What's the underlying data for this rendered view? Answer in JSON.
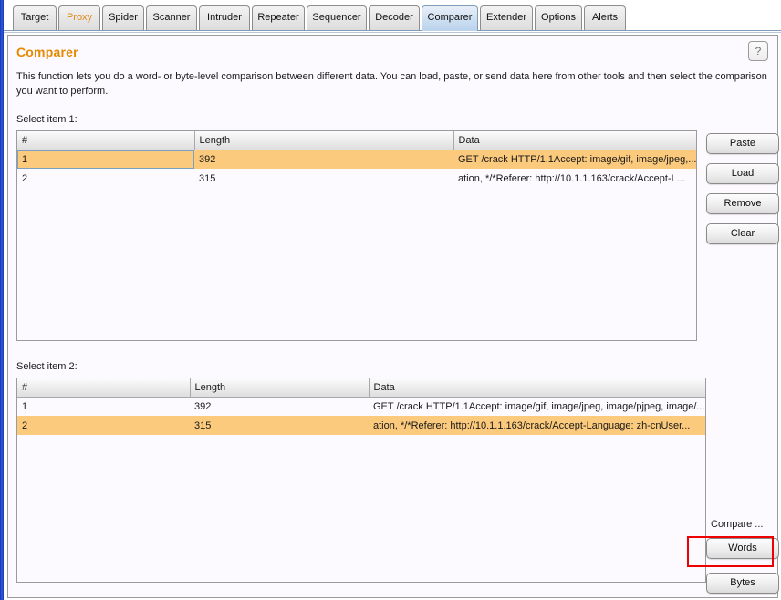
{
  "window": {
    "tabs": [
      {
        "label": "Target",
        "active": false,
        "accent": false
      },
      {
        "label": "Proxy",
        "active": false,
        "accent": true
      },
      {
        "label": "Spider",
        "active": false,
        "accent": false
      },
      {
        "label": "Scanner",
        "active": false,
        "accent": false
      },
      {
        "label": "Intruder",
        "active": false,
        "accent": false
      },
      {
        "label": "Repeater",
        "active": false,
        "accent": false
      },
      {
        "label": "Sequencer",
        "active": false,
        "accent": false
      },
      {
        "label": "Decoder",
        "active": false,
        "accent": false
      },
      {
        "label": "Comparer",
        "active": true,
        "accent": false
      },
      {
        "label": "Extender",
        "active": false,
        "accent": false
      },
      {
        "label": "Options",
        "active": false,
        "accent": false
      },
      {
        "label": "Alerts",
        "active": false,
        "accent": false
      }
    ]
  },
  "header": {
    "title": "Comparer",
    "help_label": "?",
    "description": "This function lets you do a word- or byte-level comparison between different data. You can load, paste, or send data here from other tools and then select the comparison you want to perform."
  },
  "item1": {
    "label": "Select item 1:",
    "columns": [
      "#",
      "Length",
      "Data"
    ],
    "rows": [
      {
        "number": "1",
        "length": "392",
        "data": "GET /crack HTTP/1.1Accept: image/gif, image/jpeg,...",
        "selected": true
      },
      {
        "number": "2",
        "length": "315",
        "data": "ation, */*Referer: http://10.1.1.163/crack/Accept-L...",
        "selected": false
      }
    ],
    "buttons": [
      {
        "label": "Paste"
      },
      {
        "label": "Load"
      },
      {
        "label": "Remove"
      },
      {
        "label": "Clear"
      }
    ]
  },
  "item2": {
    "label": "Select item 2:",
    "columns": [
      "#",
      "Length",
      "Data"
    ],
    "rows": [
      {
        "number": "1",
        "length": "392",
        "data": "GET /crack HTTP/1.1Accept: image/gif, image/jpeg, image/pjpeg, image/...",
        "selected": false
      },
      {
        "number": "2",
        "length": "315",
        "data": "ation, */*Referer: http://10.1.1.163/crack/Accept-Language: zh-cnUser...",
        "selected": true
      }
    ]
  },
  "compare": {
    "label": "Compare ...",
    "words_label": "Words",
    "bytes_label": "Bytes"
  },
  "colors": {
    "accent_orange": "#e58900",
    "proxy_tab": "#e08a16",
    "row_selected": "#fcca7c",
    "annotation_red": "#ee0000",
    "active_tab": "#b9d2ec"
  }
}
